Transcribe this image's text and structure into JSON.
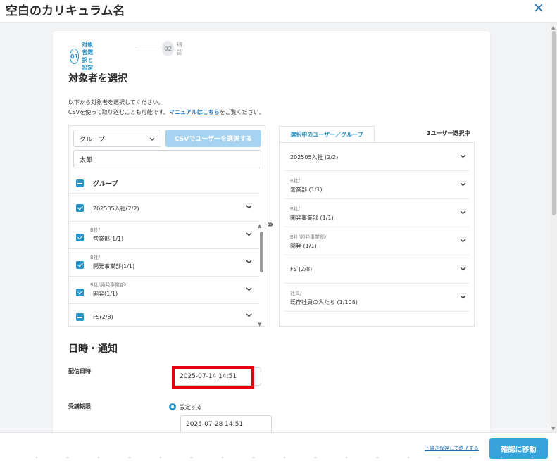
{
  "header": {
    "title": "空白のカリキュラム名",
    "close_icon": "close-icon"
  },
  "stepper": [
    {
      "num": "01",
      "label": "対象者選択と設定"
    },
    {
      "num": "02",
      "label": "確認"
    }
  ],
  "target": {
    "title": "対象者を選択",
    "desc_line1": "以下から対象者を選択してください。",
    "desc_line2_prefix": "CSVを使って取り込むことも可能です。",
    "desc_link": "マニュアルはこちら",
    "desc_line2_suffix": "をご覧ください。"
  },
  "left": {
    "select_value": "グループ",
    "csv_button": "CSVでユーザーを選択する",
    "search_value": "太郎",
    "group_header": "グループ",
    "items": [
      {
        "sub": "",
        "label": "202505入社(2/2)",
        "state": "check"
      },
      {
        "sub": "B社/",
        "label": "営業部(1/1)",
        "state": "check"
      },
      {
        "sub": "B社/",
        "label": "開発事業部(1/1)",
        "state": "check"
      },
      {
        "sub": "B社/開発事業部/",
        "label": "開発(1/1)",
        "state": "check"
      },
      {
        "sub": "",
        "label": "FS(2/8)",
        "state": "minus"
      }
    ]
  },
  "right": {
    "tab_label": "選択中のユーザー／グループ",
    "selected_count": "3ユーザー選択中",
    "items": [
      {
        "sub": "",
        "label": "202505入社 (2/2)"
      },
      {
        "sub": "B社/",
        "label": "営業部 (1/1)"
      },
      {
        "sub": "B社/",
        "label": "開発事業部 (1/1)"
      },
      {
        "sub": "B社/開発事業部/",
        "label": "開発 (1/1)"
      },
      {
        "sub": "",
        "label": "FS (2/8)"
      },
      {
        "sub": "社員/",
        "label": "既存社員の人たち (1/108)"
      }
    ]
  },
  "schedule": {
    "title": "日時・通知",
    "delivery_label": "配信日時",
    "delivery_value": "2025-07-14 14:51",
    "period_label": "受講期限",
    "period_option": "設定する",
    "period_value": "2025-07-28 14:51"
  },
  "footer": {
    "save_link": "下書き保存して終了する",
    "confirm_button": "確認に移動"
  },
  "colors": {
    "accent": "#2b95c9",
    "button": "#36a3db",
    "highlight": "#e6000f"
  }
}
